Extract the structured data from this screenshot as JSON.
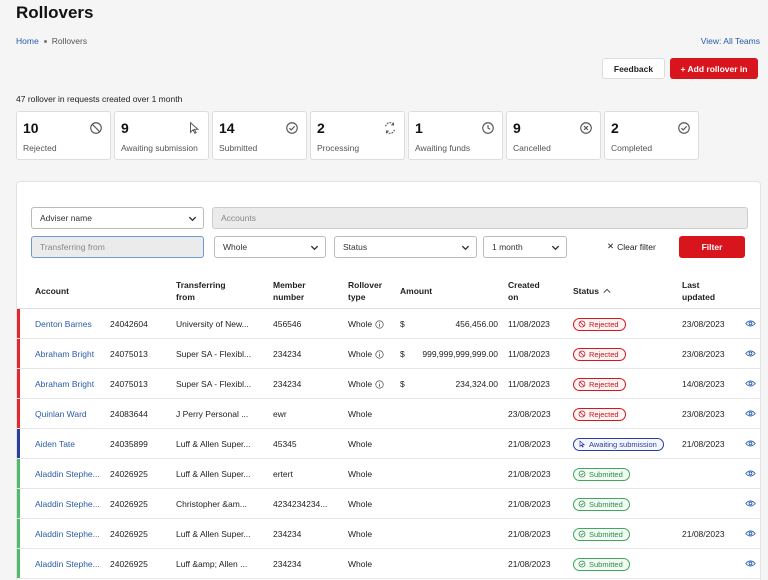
{
  "page": {
    "title": "Rollovers"
  },
  "breadcrumb": {
    "home": "Home",
    "current": "Rollovers"
  },
  "view_teams": "View: All Teams",
  "buttons": {
    "feedback": "Feedback",
    "add": "+ Add rollover in",
    "filter": "Filter",
    "clear_filter": "Clear filter"
  },
  "summary": "47 rollover in requests created over 1 month",
  "cards": [
    {
      "count": "10",
      "label": "Rejected",
      "icon": "ban-icon"
    },
    {
      "count": "9",
      "label": "Awaiting submission",
      "icon": "cursor-icon"
    },
    {
      "count": "14",
      "label": "Submitted",
      "icon": "check-circle-icon"
    },
    {
      "count": "2",
      "label": "Processing",
      "icon": "processing-icon"
    },
    {
      "count": "1",
      "label": "Awaiting funds",
      "icon": "clock-icon"
    },
    {
      "count": "9",
      "label": "Cancelled",
      "icon": "x-circle-icon"
    },
    {
      "count": "2",
      "label": "Completed",
      "icon": "check-circle-icon"
    }
  ],
  "filters": {
    "adviser": "Adviser name",
    "accounts_placeholder": "Accounts",
    "transferring_placeholder": "Transferring from",
    "whole": "Whole",
    "status": "Status",
    "period": "1 month"
  },
  "columns": {
    "account": "Account",
    "transferring_1": "Transferring",
    "transferring_2": "from",
    "member_1": "Member",
    "member_2": "number",
    "rollover_1": "Rollover",
    "rollover_2": "type",
    "amount": "Amount",
    "created_1": "Created",
    "created_2": "on",
    "status": "Status",
    "updated_1": "Last",
    "updated_2": "updated"
  },
  "colors": {
    "rejected": "#e4262d",
    "awaiting": "#2a3f9a",
    "submitted": "#52b96b",
    "accent": "#d8141c",
    "link": "#2a5caa"
  },
  "rows": [
    {
      "name": "Denton Barnes",
      "id": "24042604",
      "from": "University of New...",
      "member": "456546",
      "type": "Whole",
      "info": true,
      "currency": "$",
      "amount": "456,456.00",
      "created": "11/08/2023",
      "status": "Rejected",
      "kind": "rej",
      "updated": "23/08/2023"
    },
    {
      "name": "Abraham Bright",
      "id": "24075013",
      "from": "Super SA - Flexibl...",
      "member": "234234",
      "type": "Whole",
      "info": true,
      "currency": "$",
      "amount": "999,999,999,999.00",
      "created": "11/08/2023",
      "status": "Rejected",
      "kind": "rej",
      "updated": "23/08/2023"
    },
    {
      "name": "Abraham Bright",
      "id": "24075013",
      "from": "Super SA - Flexibl...",
      "member": "234234",
      "type": "Whole",
      "info": true,
      "currency": "$",
      "amount": "234,324.00",
      "created": "11/08/2023",
      "status": "Rejected",
      "kind": "rej",
      "updated": "14/08/2023"
    },
    {
      "name": "Quinlan Ward",
      "id": "24083644",
      "from": "J Perry Personal ...",
      "member": "ewr",
      "type": "Whole",
      "info": false,
      "currency": "",
      "amount": "",
      "created": "23/08/2023",
      "status": "Rejected",
      "kind": "rej",
      "updated": "23/08/2023"
    },
    {
      "name": "Aiden Tate",
      "id": "24035899",
      "from": "Luff & Allen Super...",
      "member": "45345",
      "type": "Whole",
      "info": false,
      "currency": "",
      "amount": "",
      "created": "21/08/2023",
      "status": "Awaiting submission",
      "kind": "aw",
      "updated": "21/08/2023"
    },
    {
      "name": "Aladdin Stephe...",
      "id": "24026925",
      "from": "Luff & Allen Super...",
      "member": "ertert",
      "type": "Whole",
      "info": false,
      "currency": "",
      "amount": "",
      "created": "21/08/2023",
      "status": "Submitted",
      "kind": "sub",
      "updated": ""
    },
    {
      "name": "Aladdin Stephe...",
      "id": "24026925",
      "from": "Christopher &am...",
      "member": "4234234234...",
      "type": "Whole",
      "info": false,
      "currency": "",
      "amount": "",
      "created": "21/08/2023",
      "status": "Submitted",
      "kind": "sub",
      "updated": ""
    },
    {
      "name": "Aladdin Stephe...",
      "id": "24026925",
      "from": "Luff & Allen Super...",
      "member": "234234",
      "type": "Whole",
      "info": false,
      "currency": "",
      "amount": "",
      "created": "21/08/2023",
      "status": "Submitted",
      "kind": "sub",
      "updated": "21/08/2023"
    },
    {
      "name": "Aladdin Stephe...",
      "id": "24026925",
      "from": "Luff &amp; Allen ...",
      "member": "234234",
      "type": "Whole",
      "info": false,
      "currency": "",
      "amount": "",
      "created": "21/08/2023",
      "status": "Submitted",
      "kind": "sub",
      "updated": ""
    }
  ]
}
